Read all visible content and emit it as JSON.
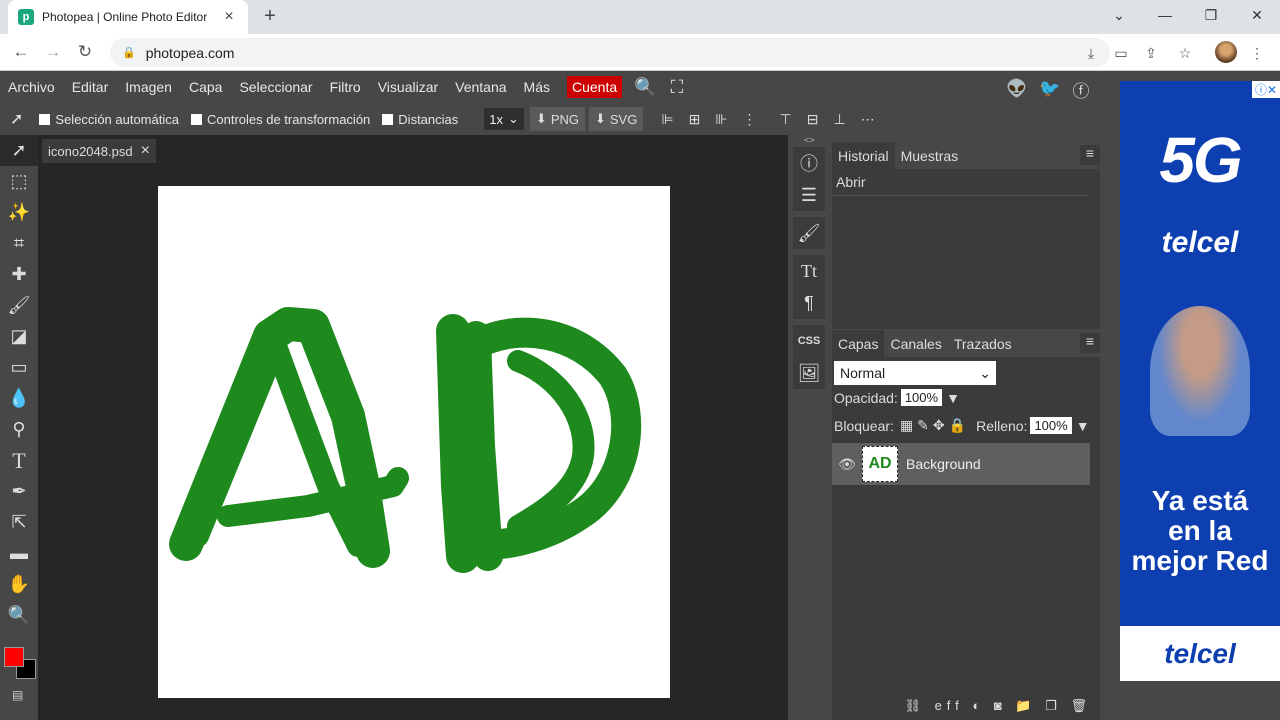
{
  "browser": {
    "tab_title": "Photopea | Online Photo Editor",
    "url": "photopea.com"
  },
  "menu": {
    "items": [
      "Archivo",
      "Editar",
      "Imagen",
      "Capa",
      "Seleccionar",
      "Filtro",
      "Visualizar",
      "Ventana",
      "Más"
    ],
    "account": "Cuenta"
  },
  "options": {
    "auto_select": "Selección automática",
    "transform_controls": "Controles de transformación",
    "distances": "Distancias",
    "zoom": "1x",
    "png": "PNG",
    "svg": "SVG"
  },
  "document": {
    "tab_name": "icono2048.psd"
  },
  "history_panel": {
    "tabs": [
      "Historial",
      "Muestras"
    ],
    "entries": [
      "Abrir"
    ]
  },
  "layers_panel": {
    "tabs": [
      "Capas",
      "Canales",
      "Trazados"
    ],
    "blend_mode": "Normal",
    "opacity_label": "Opacidad:",
    "opacity_value": "100%",
    "lock_label": "Bloquear:",
    "fill_label": "Relleno:",
    "fill_value": "100%",
    "layers": [
      {
        "name": "Background",
        "thumb_text": "AD"
      }
    ]
  },
  "side_icons": {
    "css_label": "CSS"
  },
  "colors": {
    "foreground": "#ff0000",
    "background": "#000000",
    "stroke": "#1e8a1e",
    "accent": "#cc0000"
  },
  "ad": {
    "choice": "ⓘ✕",
    "headline": "5G",
    "brand": "telcel",
    "tagline_1": "Ya está",
    "tagline_2": "en la",
    "tagline_3": "mejor Red",
    "footer_brand": "telcel"
  }
}
